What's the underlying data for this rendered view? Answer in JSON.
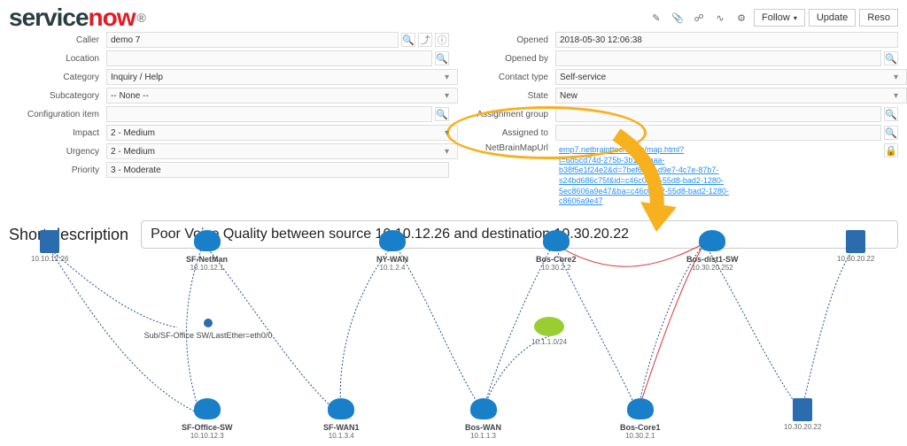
{
  "logo": {
    "part1": "service",
    "part2": "now"
  },
  "toolbar": {
    "follow": "Follow",
    "update": "Update",
    "resolve": "Reso"
  },
  "left_fields": {
    "caller_label": "Caller",
    "caller_value": "demo 7",
    "location_label": "Location",
    "location_value": "",
    "category_label": "Category",
    "category_value": "Inquiry / Help",
    "subcategory_label": "Subcategory",
    "subcategory_value": "-- None --",
    "config_item_label": "Configuration item",
    "config_item_value": "",
    "impact_label": "Impact",
    "impact_value": "2 - Medium",
    "urgency_label": "Urgency",
    "urgency_value": "2 - Medium",
    "priority_label": "Priority",
    "priority_value": "3 - Moderate"
  },
  "right_fields": {
    "opened_label": "Opened",
    "opened_value": "2018-05-30 12:06:38",
    "opened_by_label": "Opened by",
    "opened_by_value": "",
    "contact_type_label": "Contact type",
    "contact_type_value": "Self-service",
    "state_label": "State",
    "state_value": "New",
    "assignment_group_label": "Assignment group",
    "assignment_group_value": "",
    "assigned_to_label": "Assigned to",
    "assigned_to_value": "",
    "netbrain_label": "NetBrainMapUrl",
    "netbrain_url_host": "emp7.netbrainttech.com/map.html?",
    "netbrain_url_l1": "t=6d5cd74d-275b-3b15-2baa-",
    "netbrain_url_l2": "b38f5e1f24e2&d=7bef6d1b-d9e7-4c7e-87b7-",
    "netbrain_url_l3": "s24bd686c75f&id=c46c0912-55d8-bad2-1280-",
    "netbrain_url_l4": "5ec8606a9e47&ba=c46c0912-55d8-bad2-1280-",
    "netbrain_url_l5": "c8606a9e47"
  },
  "short_description": {
    "label": "Short description",
    "value": "Poor Voice Quality between source 10.10.12.26 and destination 10.30.20.22"
  },
  "topology": {
    "nodes": {
      "src_pc": {
        "name": "",
        "ip": "10.10.12.26"
      },
      "sf_netman": {
        "name": "SF-NetMan",
        "ip": "10.10.12.1"
      },
      "ny_wan": {
        "name": "NY-WAN",
        "ip": "10.1.2.4"
      },
      "bos_core2": {
        "name": "Bos-Core2",
        "ip": "10.30.2.2"
      },
      "bos_dist1_sw": {
        "name": "Bos-dist1-SW",
        "ip": "10.30.20.252"
      },
      "sf_office_sw": {
        "name": "SF-Office-SW",
        "ip": "10.10.12.3"
      },
      "sf_wan1": {
        "name": "SF-WAN1",
        "ip": "10.1.3.4"
      },
      "bos_wan": {
        "name": "Bos-WAN",
        "ip": "10.1.1.3"
      },
      "bos_core1": {
        "name": "Bos-Core1",
        "ip": "10.30.2.1"
      },
      "dst_pc": {
        "name": "",
        "ip": "10.30.20.22"
      },
      "cloud": {
        "name": "",
        "ip": "10.1.1.0/24"
      },
      "midnode": {
        "name": "Sub/SF-Office SW/LastEther=eth0/0",
        "ip": ""
      }
    }
  }
}
